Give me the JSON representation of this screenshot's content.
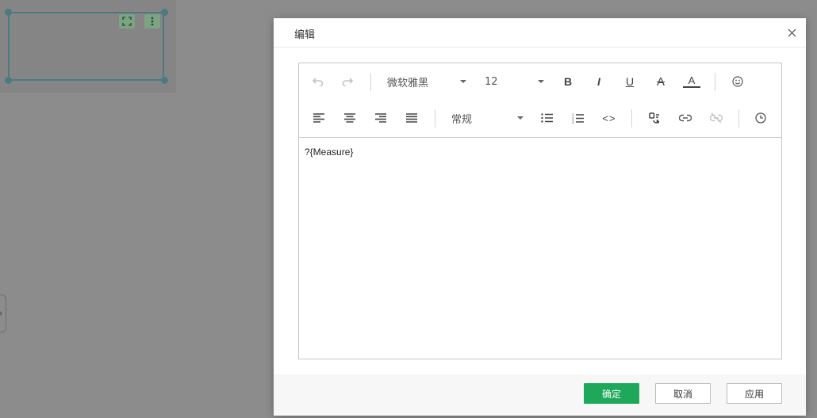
{
  "dialog": {
    "title": "编辑",
    "close_icon": "close-icon"
  },
  "toolbar": {
    "font_family": "微软雅黑",
    "font_size": "12",
    "paragraph_style": "常规",
    "icons": {
      "undo": "undo-icon",
      "redo": "redo-icon",
      "bold": "B",
      "italic": "I",
      "underline": "U",
      "strikethrough": "A",
      "font_color": "A",
      "emoji": "emoji-icon",
      "align_left": "align-left-icon",
      "align_center": "align-center-icon",
      "align_right": "align-right-icon",
      "justify": "justify-icon",
      "bullet_list": "bullet-list-icon",
      "numbered_list": "numbered-list-icon",
      "code": "<>",
      "insert_variable": "variable-icon",
      "link": "link-icon",
      "unlink": "unlink-icon",
      "clock": "clock-icon"
    }
  },
  "editor": {
    "content": "?{Measure}"
  },
  "footer": {
    "confirm_label": "确定",
    "cancel_label": "取消",
    "apply_label": "应用"
  },
  "colors": {
    "primary": "#1fa85a",
    "overlay": "#8c8c8c",
    "widget_border": "#4d7a82"
  }
}
